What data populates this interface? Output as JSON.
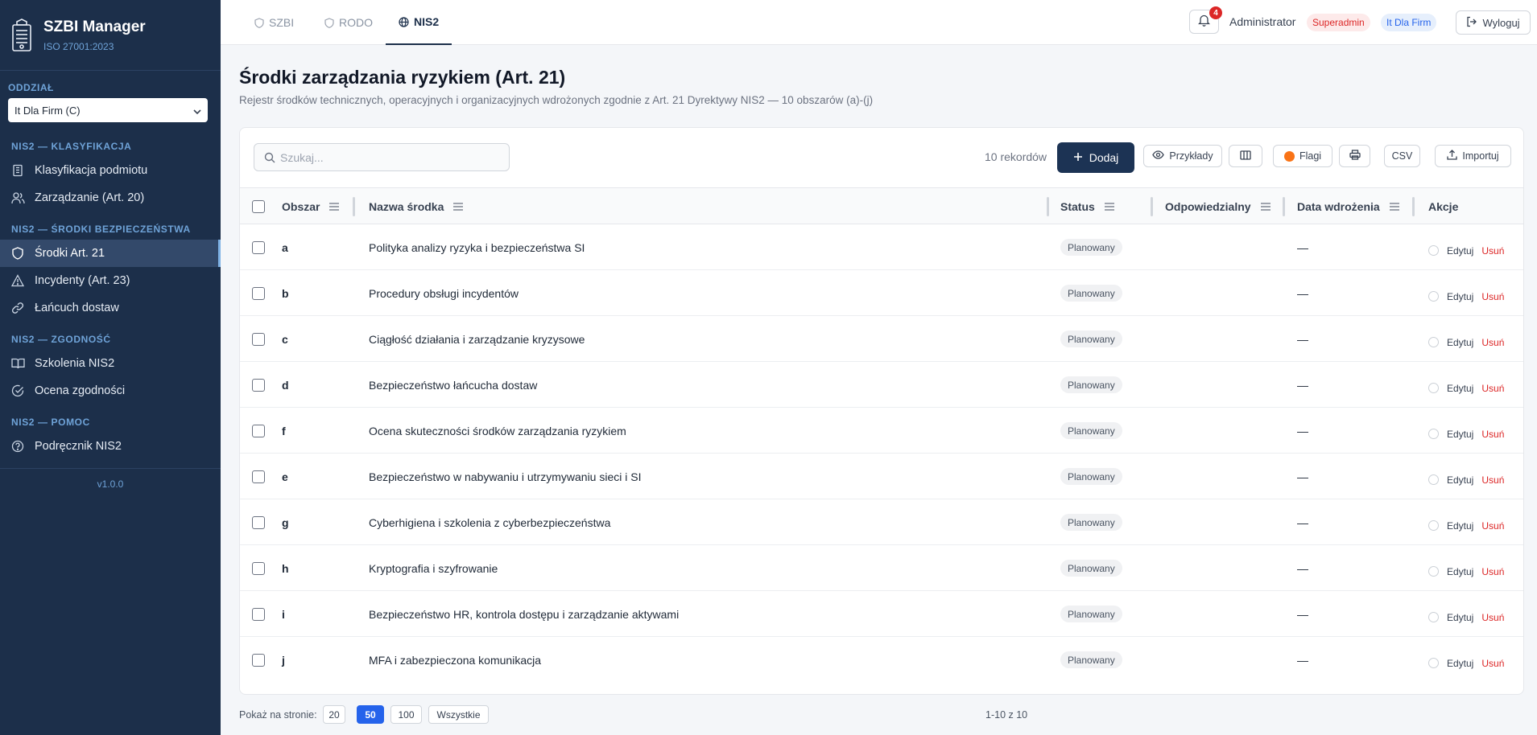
{
  "app": {
    "name": "SZBI Manager",
    "subtitle": "ISO 27001:2023",
    "version": "v1.0.0"
  },
  "branch": {
    "label": "ODDZIAŁ",
    "selected": "It Dla Firm (C)"
  },
  "nav": [
    {
      "section": "NIS2 — KLASYFIKACJA",
      "items": [
        {
          "label": "Klasyfikacja podmiotu",
          "icon": "building-icon"
        },
        {
          "label": "Zarządzanie (Art. 20)",
          "icon": "users-icon"
        }
      ]
    },
    {
      "section": "NIS2 — ŚRODKI BEZPIECZEŃSTWA",
      "items": [
        {
          "label": "Środki Art. 21",
          "icon": "shield-icon",
          "active": true
        },
        {
          "label": "Incydenty (Art. 23)",
          "icon": "warning-icon"
        },
        {
          "label": "Łańcuch dostaw",
          "icon": "link-icon"
        }
      ]
    },
    {
      "section": "NIS2 — ZGODNOŚĆ",
      "items": [
        {
          "label": "Szkolenia NIS2",
          "icon": "book-icon"
        },
        {
          "label": "Ocena zgodności",
          "icon": "check-circle-icon"
        }
      ]
    },
    {
      "section": "NIS2 — POMOC",
      "items": [
        {
          "label": "Podręcznik NIS2",
          "icon": "help-icon"
        }
      ]
    }
  ],
  "tabs": [
    {
      "label": "SZBI",
      "icon": "shield-icon"
    },
    {
      "label": "RODO",
      "icon": "shield-icon"
    },
    {
      "label": "NIS2",
      "icon": "globe-icon",
      "active": true
    }
  ],
  "header": {
    "notifications": "4",
    "user": "Administrator",
    "role": "Superadmin",
    "org": "It Dla Firm",
    "logout": "Wyloguj"
  },
  "page": {
    "title": "Środki zarządzania ryzykiem (Art. 21)",
    "subtitle": "Rejestr środków technicznych, operacyjnych i organizacyjnych wdrożonych zgodnie z Art. 21 Dyrektywy NIS2 — 10 obszarów (a)-(j)"
  },
  "toolbar": {
    "search_placeholder": "Szukaj...",
    "records": "10 rekordów",
    "add": "Dodaj",
    "examples": "Przykłady",
    "flags": "Flagi",
    "csv": "CSV",
    "import": "Importuj"
  },
  "table": {
    "columns": [
      "Obszar",
      "Nazwa środka",
      "Status",
      "Odpowiedzialny",
      "Data wdrożenia",
      "Akcje"
    ],
    "rows": [
      {
        "area": "a",
        "name": "Polityka analizy ryzyka i bezpieczeństwa SI",
        "status": "Planowany",
        "owner": "",
        "date": "—"
      },
      {
        "area": "b",
        "name": "Procedury obsługi incydentów",
        "status": "Planowany",
        "owner": "",
        "date": "—"
      },
      {
        "area": "c",
        "name": "Ciągłość działania i zarządzanie kryzysowe",
        "status": "Planowany",
        "owner": "",
        "date": "—"
      },
      {
        "area": "d",
        "name": "Bezpieczeństwo łańcucha dostaw",
        "status": "Planowany",
        "owner": "",
        "date": "—"
      },
      {
        "area": "f",
        "name": "Ocena skuteczności środków zarządzania ryzykiem",
        "status": "Planowany",
        "owner": "",
        "date": "—"
      },
      {
        "area": "e",
        "name": "Bezpieczeństwo w nabywaniu i utrzymywaniu sieci i SI",
        "status": "Planowany",
        "owner": "",
        "date": "—"
      },
      {
        "area": "g",
        "name": "Cyberhigiena i szkolenia z cyberbezpieczeństwa",
        "status": "Planowany",
        "owner": "",
        "date": "—"
      },
      {
        "area": "h",
        "name": "Kryptografia i szyfrowanie",
        "status": "Planowany",
        "owner": "",
        "date": "—"
      },
      {
        "area": "i",
        "name": "Bezpieczeństwo HR, kontrola dostępu i zarządzanie aktywami",
        "status": "Planowany",
        "owner": "",
        "date": "—"
      },
      {
        "area": "j",
        "name": "MFA i zabezpieczona komunikacja",
        "status": "Planowany",
        "owner": "",
        "date": "—"
      }
    ],
    "edit_label": "Edytuj",
    "delete_label": "Usuń"
  },
  "pagination": {
    "label": "Pokaż na stronie:",
    "options": [
      "20",
      "50",
      "100",
      "Wszystkie"
    ],
    "selected": "50",
    "range": "1-10 z 10"
  },
  "colors": {
    "sidebar": "#1c2f4a",
    "primary": "#1c3354",
    "accent": "#2563eb",
    "danger": "#dc2626"
  }
}
